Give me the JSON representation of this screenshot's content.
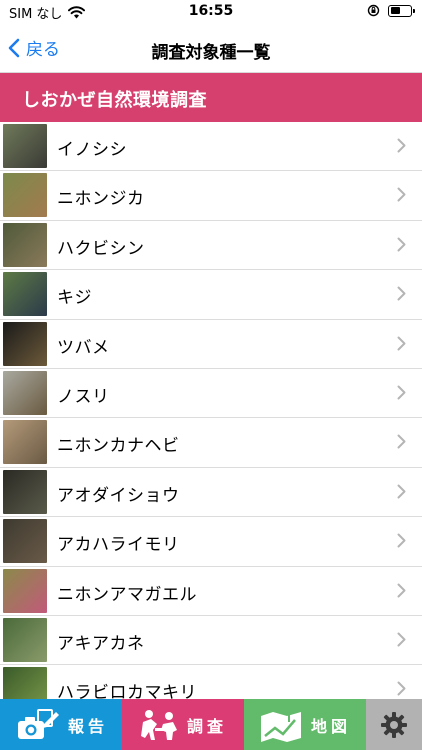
{
  "status": {
    "carrier": "SIM なし",
    "time": "16:55",
    "battery_level": 0.5
  },
  "nav": {
    "back_label": "戻る",
    "title": "調査対象種一覧"
  },
  "section": {
    "title": "しおかぜ自然環境調査",
    "color": "#d5406e"
  },
  "species": [
    {
      "name": "イノシシ",
      "thumb": [
        "#6f7a5a",
        "#3a3a35"
      ]
    },
    {
      "name": "ニホンジカ",
      "thumb": [
        "#7c8a4b",
        "#a37a4e"
      ]
    },
    {
      "name": "ハクビシン",
      "thumb": [
        "#4f5a3a",
        "#8a7a5a"
      ]
    },
    {
      "name": "キジ",
      "thumb": [
        "#5d7a45",
        "#2c3a4a"
      ]
    },
    {
      "name": "ツバメ",
      "thumb": [
        "#1a1a1a",
        "#6d5a3a"
      ]
    },
    {
      "name": "ノスリ",
      "thumb": [
        "#a9a9a0",
        "#6a5a40"
      ]
    },
    {
      "name": "ニホンカナヘビ",
      "thumb": [
        "#b49a7a",
        "#6a5a44"
      ]
    },
    {
      "name": "アオダイショウ",
      "thumb": [
        "#2a2a24",
        "#5a5a4a"
      ]
    },
    {
      "name": "アカハライモリ",
      "thumb": [
        "#3d3a30",
        "#6a5a48"
      ]
    },
    {
      "name": "ニホンアマガエル",
      "thumb": [
        "#8a8a4a",
        "#c25a7a"
      ]
    },
    {
      "name": "アキアカネ",
      "thumb": [
        "#4a6a3a",
        "#8a9a6a"
      ]
    },
    {
      "name": "ハラビロカマキリ",
      "thumb": [
        "#3a5a2a",
        "#7a9a4a"
      ]
    }
  ],
  "tabs": {
    "report": {
      "label": "報告",
      "color": "#1596d6"
    },
    "survey": {
      "label": "調査",
      "color": "#da3c73"
    },
    "map": {
      "label": "地図",
      "color": "#62bb6a"
    },
    "settings": {
      "color": "#b2b2b2"
    }
  }
}
